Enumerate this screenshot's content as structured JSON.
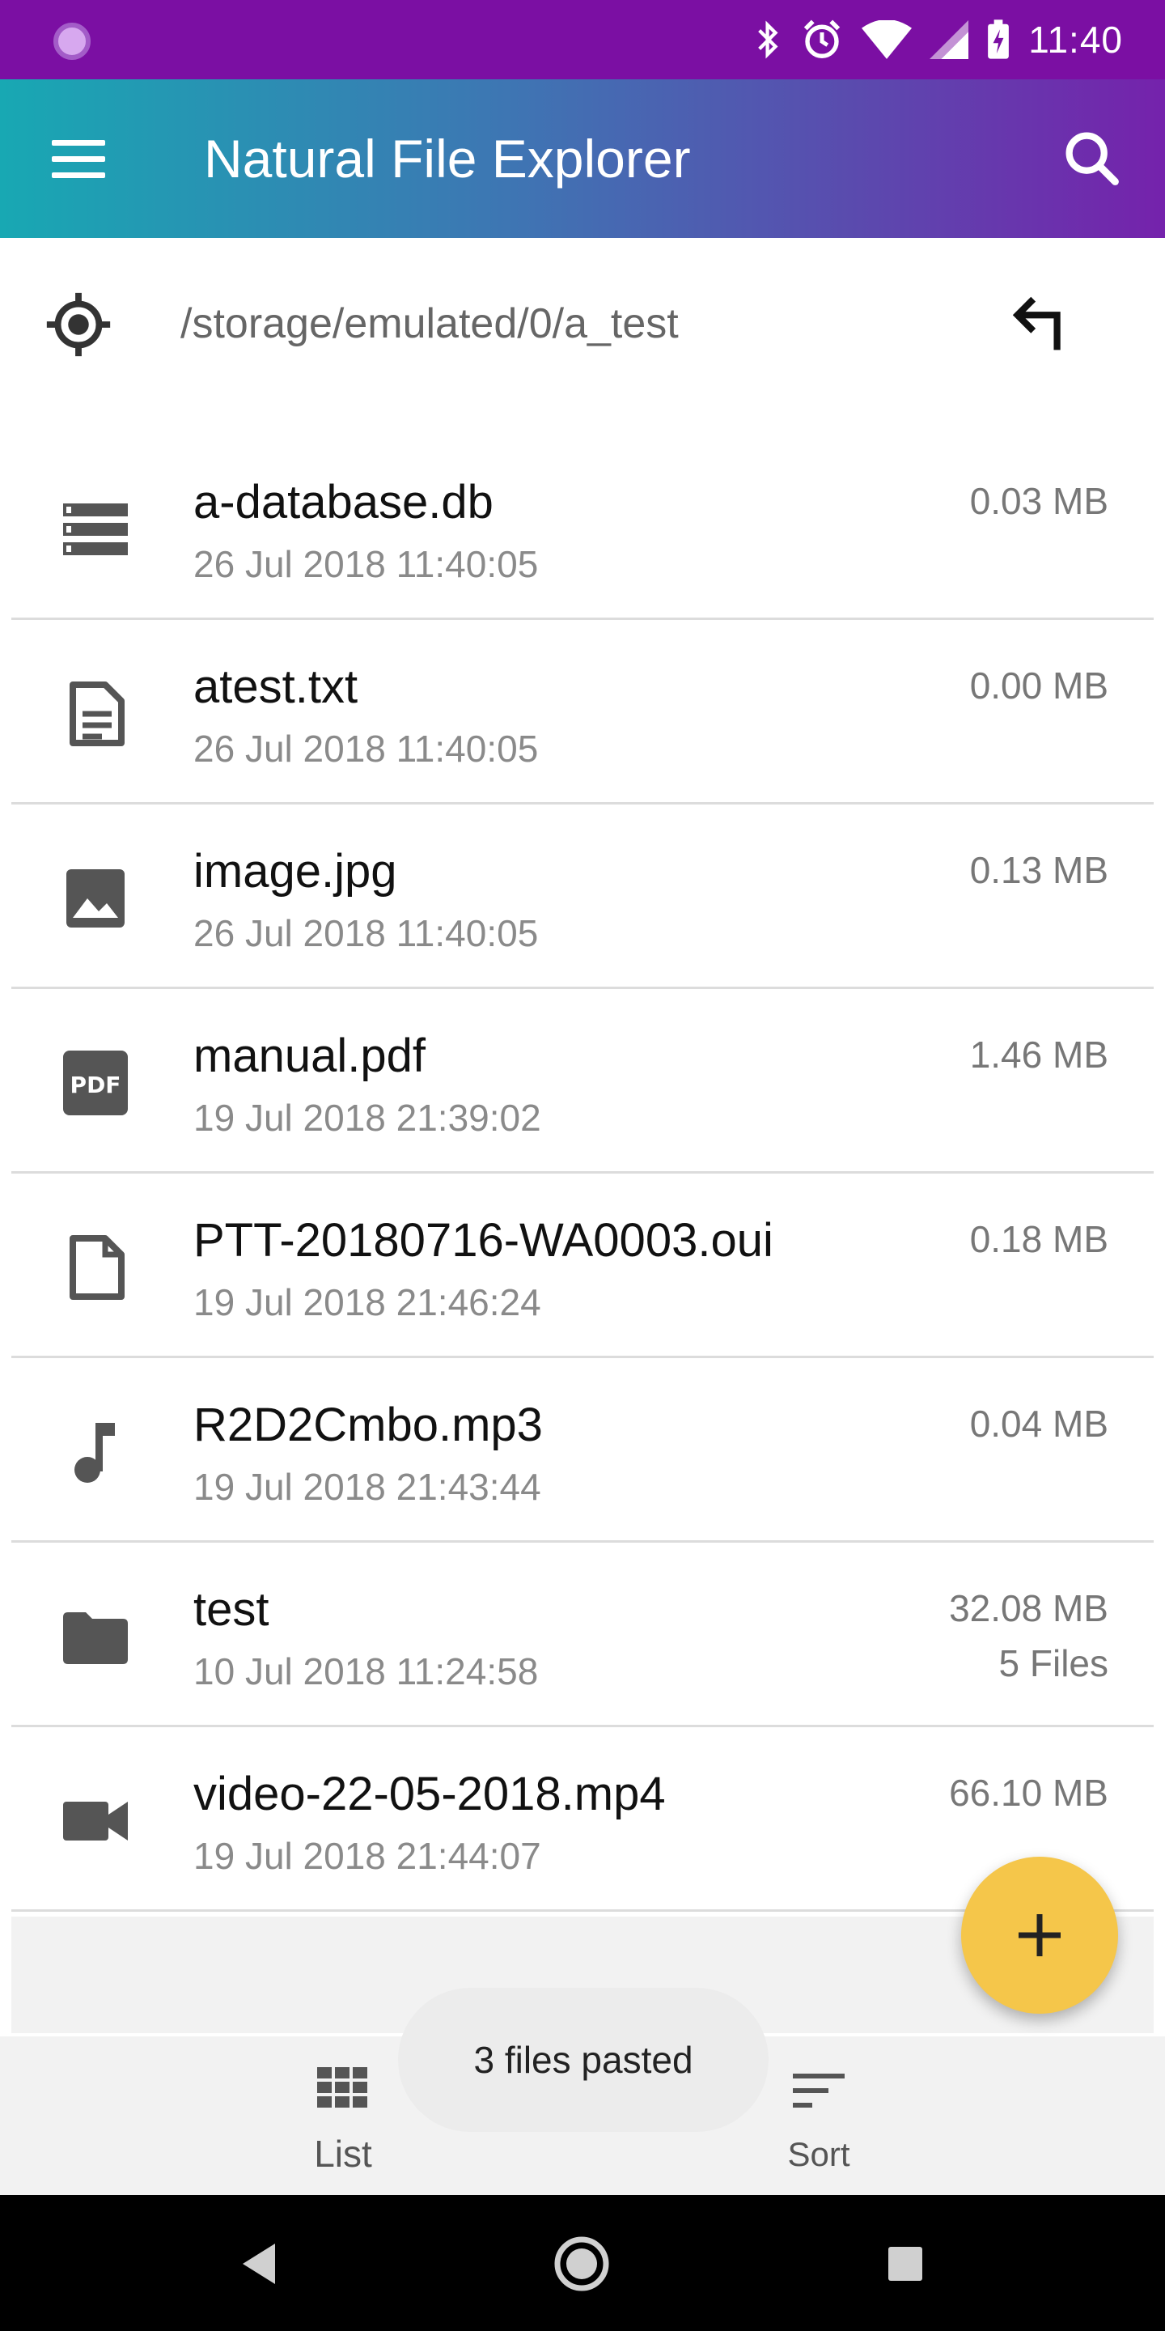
{
  "status_bar": {
    "time": "11:40"
  },
  "app_bar": {
    "title": "Natural File Explorer"
  },
  "path": {
    "current": "/storage/emulated/0/a_test"
  },
  "files": [
    {
      "name": "a-database.db",
      "date": "26 Jul 2018 11:40:05",
      "size": "0.03 MB",
      "count": "",
      "icon": "database-icon"
    },
    {
      "name": "atest.txt",
      "date": "26 Jul 2018 11:40:05",
      "size": "0.00 MB",
      "count": "",
      "icon": "text-file-icon"
    },
    {
      "name": "image.jpg",
      "date": "26 Jul 2018 11:40:05",
      "size": "0.13 MB",
      "count": "",
      "icon": "image-icon"
    },
    {
      "name": "manual.pdf",
      "date": "19 Jul 2018 21:39:02",
      "size": "1.46 MB",
      "count": "",
      "icon": "pdf-icon"
    },
    {
      "name": "PTT-20180716-WA0003.oui",
      "date": "19 Jul 2018 21:46:24",
      "size": "0.18 MB",
      "count": "",
      "icon": "generic-file-icon"
    },
    {
      "name": "R2D2Cmbo.mp3",
      "date": "19 Jul 2018 21:43:44",
      "size": "0.04 MB",
      "count": "",
      "icon": "music-note-icon"
    },
    {
      "name": "test",
      "date": "10 Jul 2018 11:24:58",
      "size": "32.08 MB",
      "count": "5 Files",
      "icon": "folder-icon"
    },
    {
      "name": "video-22-05-2018.mp4",
      "date": "19 Jul 2018 21:44:07",
      "size": "66.10 MB",
      "count": "",
      "icon": "video-camera-icon"
    }
  ],
  "pdf_icon_text": "PDF",
  "bottom_nav": {
    "list_label": "List",
    "sort_label": "Sort"
  },
  "toast": {
    "message": "3 files pasted"
  },
  "colors": {
    "status_bar": "#7b0fa3",
    "app_bar_start": "#18a8b3",
    "app_bar_end": "#7522ac",
    "fab": "#f5c64a"
  }
}
